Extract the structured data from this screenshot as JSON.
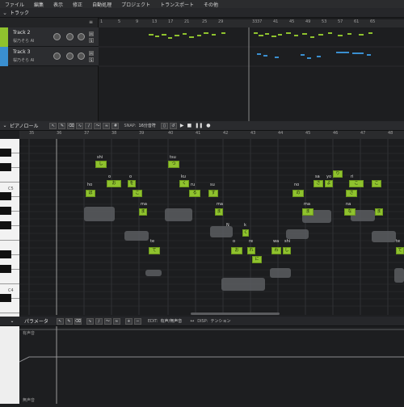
{
  "menu": [
    "ファイル",
    "編集",
    "表示",
    "修正",
    "自動処理",
    "プロジェクト",
    "トランスポート",
    "その他"
  ],
  "tracks_header": {
    "title": "トラック"
  },
  "tracks": [
    {
      "name": "Track 2",
      "singer": "桜乃そら AI",
      "color": "#8fc22e",
      "m": "M",
      "s": "S"
    },
    {
      "name": "Track 3",
      "singer": "桜乃そら AI",
      "color": "#3a8fd0",
      "m": "M",
      "s": "S"
    }
  ],
  "track_ruler": [
    "1",
    "5",
    "9",
    "13",
    "17",
    "21",
    "25",
    "29",
    "33",
    "37",
    "41",
    "45",
    "49",
    "53",
    "57",
    "61",
    "65"
  ],
  "piano_roll": {
    "title": "ピアノロール",
    "snap_label": "SNAP:",
    "snap_value": "16分音符",
    "ruler": [
      "35",
      "36",
      "37",
      "38",
      "39",
      "40",
      "41",
      "42",
      "43",
      "44",
      "45",
      "46",
      "47",
      "48"
    ],
    "key_labels": [
      "C5",
      "C4"
    ]
  },
  "notes": [
    {
      "text": "し",
      "lyric": "shi"
    },
    {
      "text": "つ",
      "lyric": "tsu"
    },
    {
      "text": "ほ",
      "lyric": "ho"
    },
    {
      "text": "お",
      "lyric": "o"
    },
    {
      "text": "を",
      "lyric": "o"
    },
    {
      "text": "く",
      "lyric": "ku"
    },
    {
      "text": "る",
      "lyric": "ru"
    },
    {
      "text": "す",
      "lyric": "su"
    },
    {
      "text": "の",
      "lyric": "no"
    },
    {
      "text": "さ",
      "lyric": "sa"
    },
    {
      "text": "よ",
      "lyric": "yo"
    },
    {
      "text": "り",
      "lyric": "ri"
    },
    {
      "text": "こ",
      "lyric": "ko"
    },
    {
      "text": "ま",
      "lyric": "ma"
    },
    {
      "text": "ま",
      "lyric": "ma"
    },
    {
      "text": "ま",
      "lyric": "ma"
    },
    {
      "text": "な",
      "lyric": "na"
    },
    {
      "text": "て",
      "lyric": "te"
    },
    {
      "text": "ん",
      "lyric": "N"
    },
    {
      "text": "く",
      "lyric": "k"
    },
    {
      "text": "お",
      "lyric": "o"
    },
    {
      "text": "れ",
      "lyric": "re"
    },
    {
      "text": "に",
      "lyric": "ni"
    },
    {
      "text": "わ",
      "lyric": "wa"
    },
    {
      "text": "し",
      "lyric": "shi"
    },
    {
      "text": "て",
      "lyric": "te"
    }
  ],
  "parameters": {
    "title": "パラメータ",
    "edit_label": "EDIT:",
    "edit_value": "有声/無声音",
    "disp_label": "DISP:",
    "disp_value": "テンション",
    "track_label_top": "有声音",
    "track_label_bottom": "無声音"
  }
}
